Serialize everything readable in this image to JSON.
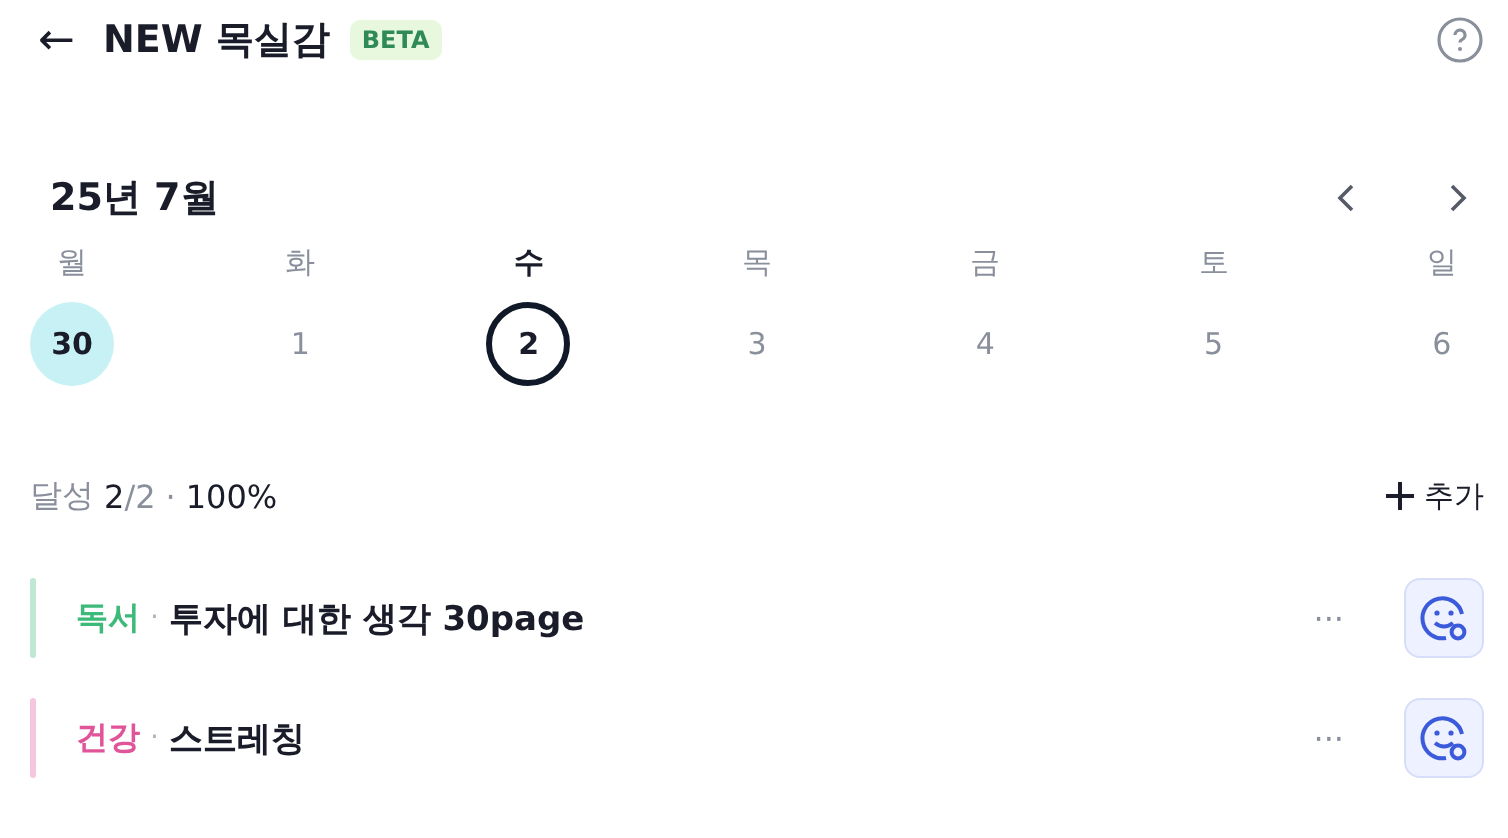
{
  "header": {
    "back": "←",
    "title": "NEW 목실감",
    "badge": "BETA"
  },
  "calendar": {
    "title": "25년 7월",
    "weekdays": [
      "월",
      "화",
      "수",
      "목",
      "금",
      "토",
      "일"
    ],
    "days": [
      {
        "label": "30",
        "selected": false,
        "marked": true
      },
      {
        "label": "1",
        "selected": false,
        "marked": false
      },
      {
        "label": "2",
        "selected": true,
        "marked": false
      },
      {
        "label": "3",
        "selected": false,
        "marked": false
      },
      {
        "label": "4",
        "selected": false,
        "marked": false
      },
      {
        "label": "5",
        "selected": false,
        "marked": false
      },
      {
        "label": "6",
        "selected": false,
        "marked": false
      }
    ]
  },
  "summary": {
    "label": "달성",
    "done": "2",
    "total": "/2",
    "separator": "·",
    "percent": "100%",
    "add": "추가"
  },
  "tasks": [
    {
      "category": "독서",
      "separator": "·",
      "title": "투자에 대한 생각 30page",
      "color": "#3dba7a",
      "more": "···"
    },
    {
      "category": "건강",
      "separator": "·",
      "title": "스트레칭",
      "color": "#e0559a",
      "more": "···"
    }
  ]
}
